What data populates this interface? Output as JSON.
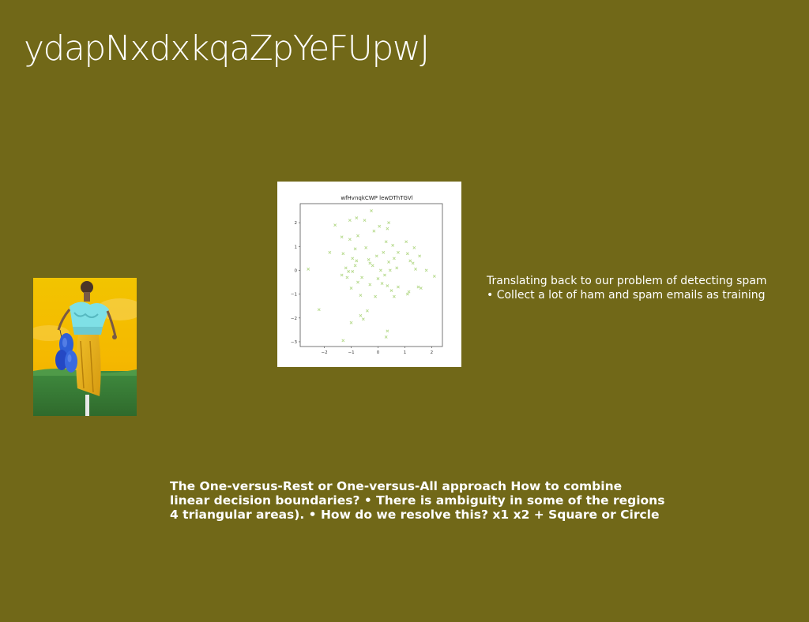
{
  "slide": {
    "title": "ydapNxdxkqaZpYeFUpwJ",
    "background_color": "#716818",
    "side_text": {
      "line1": "Translating back to our problem of detecting spam",
      "line2": "• Collect a lot of ham and spam emails as training"
    },
    "body_text": {
      "line1": "The One-versus-Rest or One-versus-All approach How to combine",
      "line2": "linear decision boundaries? • There is ambiguity in some of the regions",
      "line3": "4 triangular areas). • How do we resolve this? x1 x2 + Square or Circle"
    },
    "photo": {
      "description_icon": "photo-person-with-balloons"
    }
  },
  "chart_data": {
    "type": "scatter",
    "title": "wfHvnqkCWP lewDThTGVl",
    "xlabel": "",
    "ylabel": "",
    "xlim": [
      -2.9,
      2.4
    ],
    "ylim": [
      -3.2,
      2.8
    ],
    "xticks": [
      -2,
      -1,
      0,
      1,
      2
    ],
    "yticks": [
      2,
      1,
      0,
      -1,
      -2,
      -3
    ],
    "marker": "x",
    "color": "#b5d98a",
    "series": [
      {
        "points": [
          [
            -2.6,
            0.05
          ],
          [
            -2.2,
            -1.65
          ],
          [
            -1.8,
            0.75
          ],
          [
            -1.6,
            1.9
          ],
          [
            -1.35,
            1.4
          ],
          [
            -1.35,
            -0.2
          ],
          [
            -1.3,
            0.7
          ],
          [
            -1.3,
            -2.95
          ],
          [
            -1.2,
            0.1
          ],
          [
            -1.15,
            -0.3
          ],
          [
            -1.1,
            -0.05
          ],
          [
            -1.05,
            1.3
          ],
          [
            -1.05,
            2.1
          ],
          [
            -1.0,
            -0.75
          ],
          [
            -1.0,
            -2.2
          ],
          [
            -0.95,
            -0.05
          ],
          [
            -0.95,
            0.5
          ],
          [
            -0.85,
            0.9
          ],
          [
            -0.85,
            0.2
          ],
          [
            -0.8,
            0.4
          ],
          [
            -0.8,
            2.2
          ],
          [
            -0.75,
            -0.5
          ],
          [
            -0.75,
            1.45
          ],
          [
            -0.65,
            -1.05
          ],
          [
            -0.65,
            -1.9
          ],
          [
            -0.6,
            -0.3
          ],
          [
            -0.55,
            -2.05
          ],
          [
            -0.5,
            2.1
          ],
          [
            -0.45,
            0.95
          ],
          [
            -0.4,
            -1.7
          ],
          [
            -0.35,
            0.45
          ],
          [
            -0.3,
            0.3
          ],
          [
            -0.3,
            -0.6
          ],
          [
            -0.2,
            0.2
          ],
          [
            -0.25,
            2.5
          ],
          [
            -0.15,
            1.65
          ],
          [
            -0.1,
            -1.1
          ],
          [
            -0.05,
            0.6
          ],
          [
            0.0,
            -0.35
          ],
          [
            0.05,
            1.85
          ],
          [
            0.1,
            0.0
          ],
          [
            0.15,
            -0.55
          ],
          [
            0.2,
            0.75
          ],
          [
            0.25,
            -0.2
          ],
          [
            0.3,
            1.2
          ],
          [
            0.35,
            -0.65
          ],
          [
            0.35,
            -2.55
          ],
          [
            0.35,
            1.75
          ],
          [
            0.4,
            2.0
          ],
          [
            0.4,
            0.35
          ],
          [
            0.45,
            0.0
          ],
          [
            0.5,
            -0.85
          ],
          [
            0.55,
            1.05
          ],
          [
            0.6,
            -1.1
          ],
          [
            0.6,
            0.5
          ],
          [
            0.7,
            0.1
          ],
          [
            0.75,
            -0.7
          ],
          [
            0.75,
            0.75
          ],
          [
            0.3,
            -2.8
          ],
          [
            1.05,
            1.2
          ],
          [
            1.1,
            0.7
          ],
          [
            1.1,
            -1.0
          ],
          [
            1.15,
            -0.9
          ],
          [
            1.3,
            0.3
          ],
          [
            1.35,
            0.95
          ],
          [
            1.5,
            -0.7
          ],
          [
            1.55,
            0.6
          ],
          [
            1.6,
            -0.75
          ],
          [
            1.8,
            0.0
          ],
          [
            2.1,
            -0.25
          ],
          [
            1.2,
            0.4
          ],
          [
            1.4,
            0.05
          ]
        ]
      }
    ]
  }
}
